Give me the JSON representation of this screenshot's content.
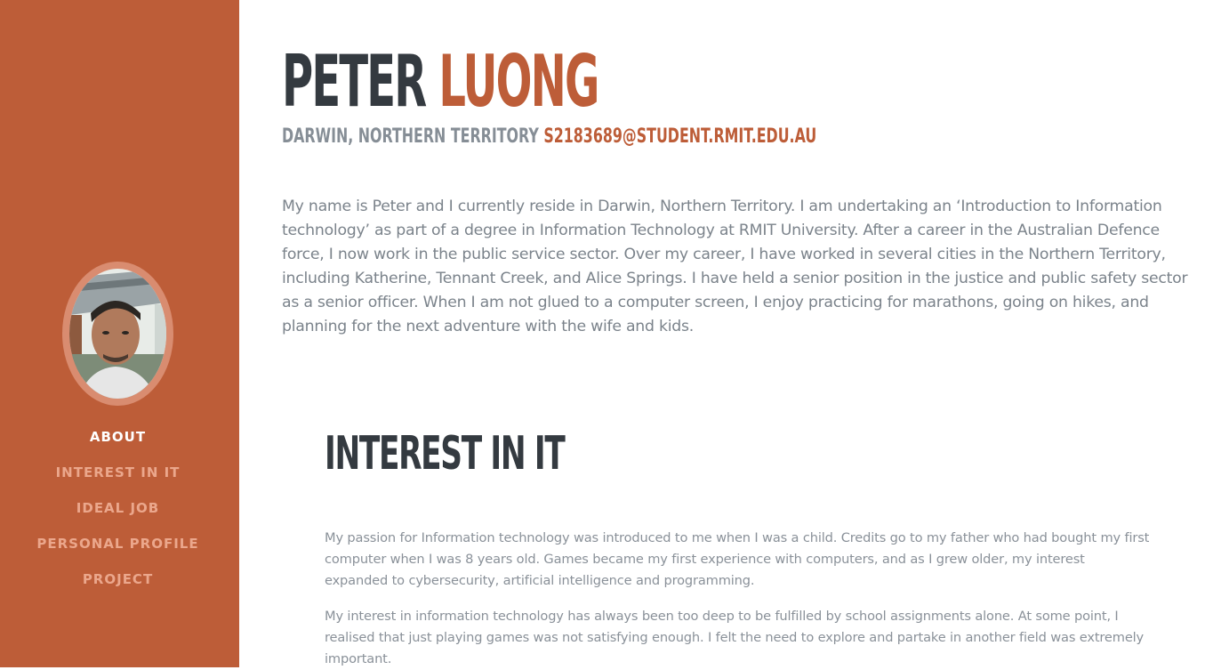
{
  "sidebar": {
    "nav": [
      {
        "label": "ABOUT",
        "active": true
      },
      {
        "label": "INTEREST IN IT",
        "active": false
      },
      {
        "label": "IDEAL JOB",
        "active": false
      },
      {
        "label": "PERSONAL PROFILE",
        "active": false
      },
      {
        "label": "PROJECT",
        "active": false
      }
    ],
    "avatar_icon": "profile-photo"
  },
  "header": {
    "first_name": "PETER",
    "last_name": "LUONG",
    "location": "DARWIN, NORTHERN TERRITORY",
    "email": "S2183689@STUDENT.RMIT.EDU.AU"
  },
  "about": {
    "text": "My name is Peter and I currently reside in Darwin, Northern Territory. I am undertaking an ‘Introduction to Information technology’ as part of a degree in Information Technology at RMIT University. After a career in the Australian Defence force, I now work in the public service sector. Over my career, I have worked in several cities in the Northern Territory, including Katherine, Tennant Creek, and Alice Springs. I have held a senior position in the justice and public safety sector as a senior officer. When I am not glued to a computer screen, I enjoy practicing for marathons, going on hikes, and planning for the next adventure with the wife and kids."
  },
  "interest": {
    "title": "INTEREST IN IT",
    "paragraph1": "My passion for Information technology was introduced to me when I was a child. Credits go to my father who had bought my first computer when I was 8 years old. Games became my first experience with computers, and as I grew older, my interest expanded to cybersecurity, artificial intelligence and programming.",
    "paragraph2": "My interest in information technology has always been too deep to be fulfilled by school assignments alone. At some point, I realised that just playing games was not satisfying enough. I felt the need to explore and partake in another field was extremely important."
  },
  "colors": {
    "primary": "#bd5d38",
    "dark": "#343a40",
    "muted": "#868e96"
  }
}
